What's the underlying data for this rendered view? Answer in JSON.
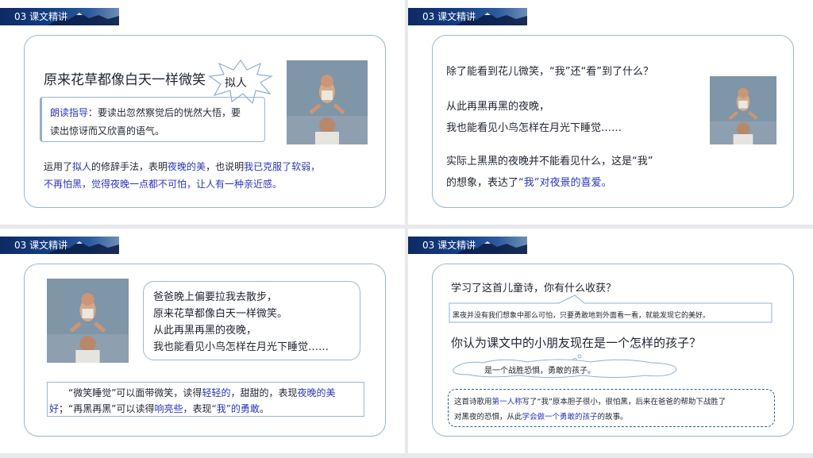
{
  "section_label": "03 课文精讲",
  "slide1": {
    "heading": "原来花草都像白天一样微笑",
    "burst_label": "拟人",
    "guide_title": "朗读指导",
    "guide_line1": "：要读出忽然察觉后的恍然大悟，要",
    "guide_line2": "读出惊讶而又欣喜的语气。",
    "p1_a": "运用了",
    "p1_b": "拟人",
    "p1_c": "的修辞手法，表明",
    "p1_d": "夜晚的美",
    "p1_e": "，也说明",
    "p1_f": "我已克服了软弱，",
    "p2": "不再怕黑，觉得夜晚一点都不可怕，让人有一种亲近感。"
  },
  "slide2": {
    "question": "除了能看到花儿微笑，“我”还“看”到了什么？",
    "line1": "从此再黑再黑的夜晚，",
    "line2": "我也能看见小鸟怎样在月光下睡觉……",
    "line3": "实际上黑黑的夜晚并不能看见什么，这是“我”",
    "line4_a": "的想象，表达了",
    "line4_b": "“我”对夜景的喜爱。"
  },
  "slide3": {
    "poem1": "爸爸晚上偏要拉我去散步，",
    "poem2": "原来花草都像白天一样微笑。",
    "poem3": "从此再黑再黑的夜晚，",
    "poem4": "我也能看见小鸟怎样在月光下睡觉……",
    "n1_a": "“微笑睡觉”可以面带微笑，读得",
    "n1_b": "轻轻的",
    "n1_c": "，甜甜的，表现",
    "n1_d": "夜晚的美",
    "n2_a": "好",
    "n2_b": "；“再黑再黑”可以读得",
    "n2_c": "响亮些",
    "n2_d": "，表现",
    "n2_e": "“我”的勇敢",
    "n2_f": "。"
  },
  "slide4": {
    "q1": "学习了这首儿童诗，你有什么收获？",
    "a1": "黑夜并没有我们想象中那么可怕，只要勇敢地到外面看一看，就能发现它的美好。",
    "q2": "你认为课文中的小朋友现在是一个怎样的孩子？",
    "a2": "是一个战胜恐惧，勇敢的孩子。",
    "s_a": "这首诗歌用",
    "s_b": "第一人称",
    "s_c": "写了“我”原本胆子很小，很怕黑，后来在爸爸的帮助下战胜了",
    "s_d": "对黑夜的恐惧，从此",
    "s_e": "学会做一个勇敢的孩子",
    "s_f": "的故事。"
  },
  "colors": {
    "accent_blue": "#2b35b8",
    "card_border": "#9cb7cc",
    "header_navy": "#163f86",
    "dashed_border": "#2a5f86"
  }
}
